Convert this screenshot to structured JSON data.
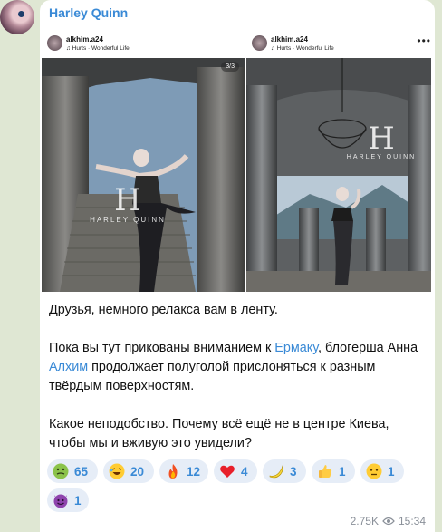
{
  "message": {
    "author": "Harley Quinn",
    "views": "2.75K",
    "time": "15:34"
  },
  "posts": [
    {
      "username": "alkhim.a24",
      "song": "♫ Hurts · Wonderful Life",
      "counter": "3/3",
      "logo_mark": "H",
      "logo_text": "HARLEY QUINN"
    },
    {
      "username": "alkhim.a24",
      "song": "♫ Hurts · Wonderful Life",
      "logo_mark": "H",
      "logo_text": "HARLEY QUINN"
    }
  ],
  "caption": {
    "line1": "Друзья, немного релакса вам в ленту.",
    "p2_pre": "Пока вы тут прикованы вниманием к ",
    "p2_link1": "Ермаку",
    "p2_mid": ", блогерша Анна ",
    "p2_link2": "Алхим",
    "p2_post": " продолжает полуголой прислоняться к разным твёрдым поверхностям.",
    "p3": "Какое неподобство. Почему всё ещё не в центре Киева, чтобы мы и вживую это увидели?"
  },
  "reactions": [
    {
      "emoji": "nauseated-face",
      "count": "65"
    },
    {
      "emoji": "rofl-face",
      "count": "20"
    },
    {
      "emoji": "fire",
      "count": "12"
    },
    {
      "emoji": "red-heart",
      "count": "4"
    },
    {
      "emoji": "banana",
      "count": "3"
    },
    {
      "emoji": "thumbs-up",
      "count": "1"
    },
    {
      "emoji": "neutral-face",
      "count": "1"
    },
    {
      "emoji": "smiling-imp",
      "count": "1"
    }
  ],
  "colors": {
    "background": "#dfe7d3",
    "accent": "#3a8ad6",
    "pill": "#e6edf7"
  }
}
